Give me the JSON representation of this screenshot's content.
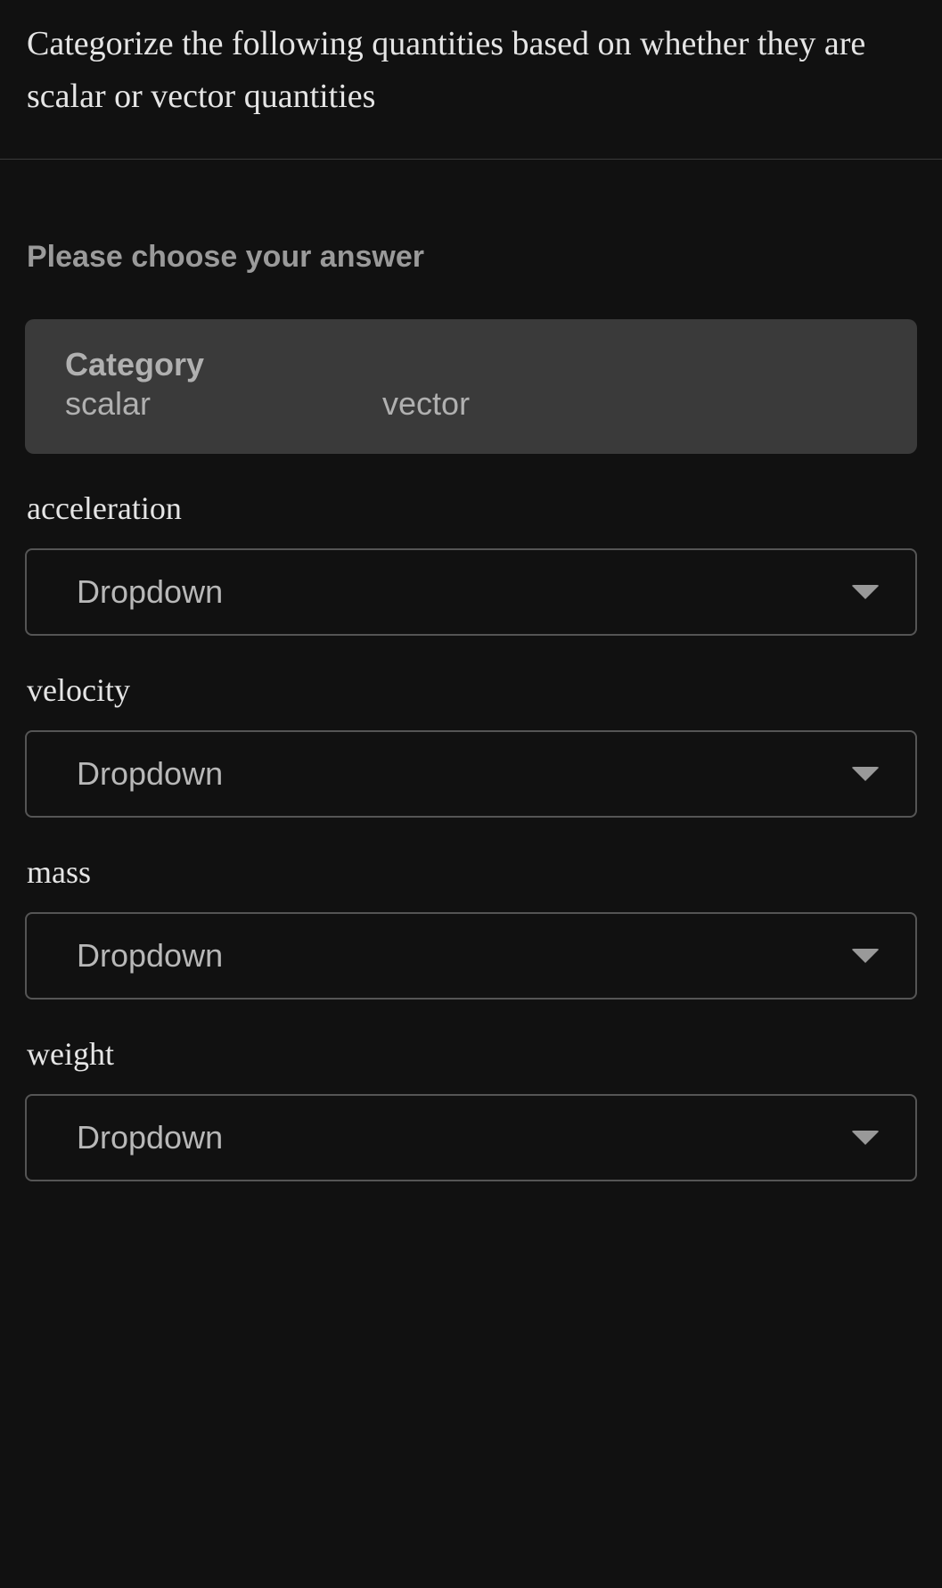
{
  "question": "Categorize the following quantities based on whether they are scalar or vector quantities",
  "instruction": "Please choose your answer",
  "category": {
    "header": "Category",
    "options": [
      "scalar",
      "vector"
    ]
  },
  "items": [
    {
      "label": "acceleration",
      "dropdown": "Dropdown"
    },
    {
      "label": "velocity",
      "dropdown": "Dropdown"
    },
    {
      "label": "mass",
      "dropdown": "Dropdown"
    },
    {
      "label": "weight",
      "dropdown": "Dropdown"
    }
  ]
}
